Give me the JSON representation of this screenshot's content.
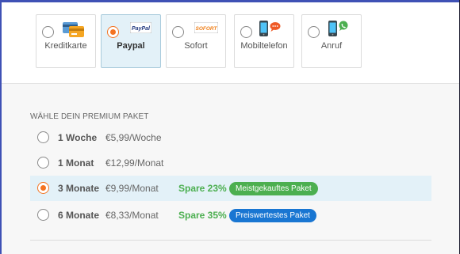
{
  "payment_methods": [
    {
      "label": "Kreditkarte",
      "icon": "credit-card-icon",
      "selected": false
    },
    {
      "label": "Paypal",
      "icon": "paypal-logo",
      "logo_text": "PayPal",
      "selected": true
    },
    {
      "label": "Sofort",
      "icon": "sofort-logo",
      "logo_text": "SOFORT",
      "selected": false
    },
    {
      "label": "Mobiltelefon",
      "icon": "mobile-sms-icon",
      "selected": false
    },
    {
      "label": "Anruf",
      "icon": "mobile-call-icon",
      "selected": false
    }
  ],
  "premium": {
    "title": "WÄHLE DEIN PREMIUM PAKET",
    "packages": [
      {
        "duration": "1 Woche",
        "price": "€5,99/Woche",
        "save": "",
        "badge": "",
        "selected": false
      },
      {
        "duration": "1 Monat",
        "price": "€12,99/Monat",
        "save": "",
        "badge": "",
        "selected": false
      },
      {
        "duration": "3 Monate",
        "price": "€9,99/Monat",
        "save": "Spare 23%",
        "badge": "Meistgekauftes Paket",
        "badge_color": "#4caf50",
        "selected": true
      },
      {
        "duration": "6 Monate",
        "price": "€8,33/Monat",
        "save": "Spare 35%",
        "badge": "Preiswertestes Paket",
        "badge_color": "#1976d2",
        "selected": false
      }
    ]
  },
  "colors": {
    "accent": "#f47321",
    "selected_bg": "#e3f1f8",
    "save_green": "#4caf50",
    "badge_blue": "#1976d2",
    "frame": "#3f51b5"
  }
}
